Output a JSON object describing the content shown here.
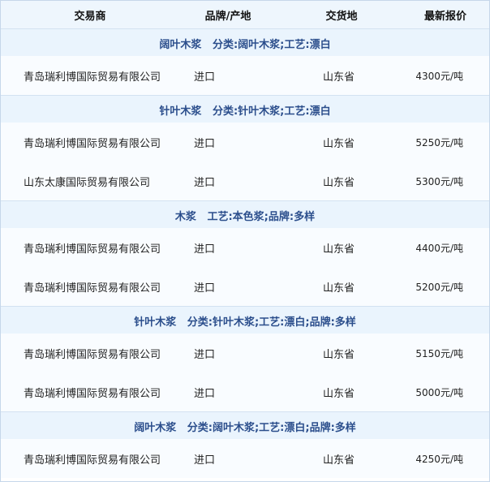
{
  "header": {
    "trader": "交易商",
    "brand_origin": "品牌/产地",
    "delivery": "交货地",
    "latest_price": "最新报价"
  },
  "groups": [
    {
      "title": "阔叶木浆   分类:阔叶木浆;工艺:漂白",
      "rows": [
        {
          "trader": "青岛瑞利博国际贸易有限公司",
          "origin": "进口",
          "delivery": "山东省",
          "price": "4300元/吨"
        }
      ]
    },
    {
      "title": "针叶木浆   分类:针叶木浆;工艺:漂白",
      "rows": [
        {
          "trader": "青岛瑞利博国际贸易有限公司",
          "origin": "进口",
          "delivery": "山东省",
          "price": "5250元/吨"
        },
        {
          "trader": "山东太康国际贸易有限公司",
          "origin": "进口",
          "delivery": "山东省",
          "price": "5300元/吨"
        }
      ]
    },
    {
      "title": "木浆   工艺:本色浆;品牌:多样",
      "rows": [
        {
          "trader": "青岛瑞利博国际贸易有限公司",
          "origin": "进口",
          "delivery": "山东省",
          "price": "4400元/吨"
        },
        {
          "trader": "青岛瑞利博国际贸易有限公司",
          "origin": "进口",
          "delivery": "山东省",
          "price": "5200元/吨"
        }
      ]
    },
    {
      "title": "针叶木浆   分类:针叶木浆;工艺:漂白;品牌:多样",
      "rows": [
        {
          "trader": "青岛瑞利博国际贸易有限公司",
          "origin": "进口",
          "delivery": "山东省",
          "price": "5150元/吨"
        },
        {
          "trader": "青岛瑞利博国际贸易有限公司",
          "origin": "进口",
          "delivery": "山东省",
          "price": "5000元/吨"
        }
      ]
    },
    {
      "title": "阔叶木浆   分类:阔叶木浆;工艺:漂白;品牌:多样",
      "rows": [
        {
          "trader": "青岛瑞利博国际贸易有限公司",
          "origin": "进口",
          "delivery": "山东省",
          "price": "4250元/吨"
        }
      ]
    }
  ]
}
